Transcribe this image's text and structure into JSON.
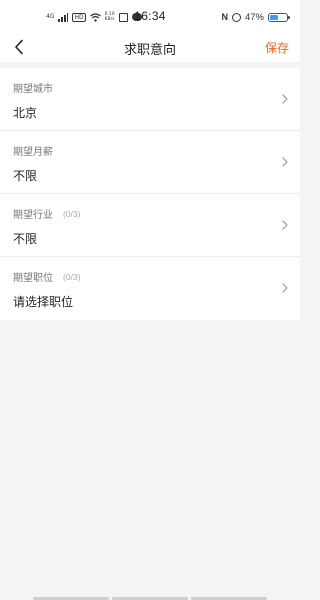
{
  "status_bar": {
    "network": "4G",
    "hd": "HD",
    "speed_value": "0.10",
    "speed_unit": "KB/s",
    "time": "16:34",
    "nfc": "N",
    "battery_text": "47%",
    "battery_level": 0.47
  },
  "nav": {
    "title": "求职意向",
    "save_label": "保存"
  },
  "rows": [
    {
      "label": "期望城市",
      "count": "",
      "value": "北京"
    },
    {
      "label": "期望月薪",
      "count": "",
      "value": "不限"
    },
    {
      "label": "期望行业",
      "count": "(0/3)",
      "value": "不限"
    },
    {
      "label": "期望职位",
      "count": "(0/3)",
      "value": "请选择职位"
    }
  ],
  "colors": {
    "accent": "#f26522",
    "background": "#f4f4f4",
    "battery": "#3b9df8"
  }
}
